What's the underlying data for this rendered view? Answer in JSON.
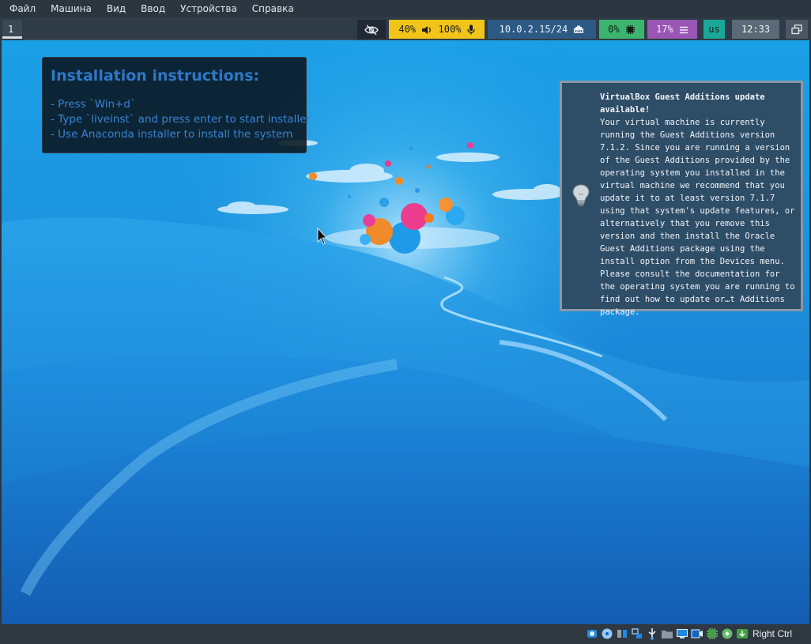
{
  "menubar": {
    "items": [
      "Файл",
      "Машина",
      "Вид",
      "Ввод",
      "Устройства",
      "Справка"
    ]
  },
  "bar": {
    "workspace": "1",
    "volume": "40%",
    "mic": "100%",
    "ip": "10.0.2.15/24",
    "cpu": "0%",
    "memory": "17%",
    "keyboard": "us",
    "clock": "12:33",
    "colors": {
      "audio": "#f0c419",
      "network": "#2d5a85",
      "cpu": "#3cb46d",
      "memory": "#9a56b5",
      "keyboard": "#1aa79a",
      "clock": "#5b6a78"
    }
  },
  "instructions": {
    "title": "Installation instructions:",
    "lines": [
      "- Press `Win+d`",
      "- Type `liveinst` and press enter to start installer",
      "- Use Anaconda installer to install the system"
    ]
  },
  "notification": {
    "title": "VirtualBox Guest Additions update available!",
    "body": "Your virtual machine is currently running the Guest Additions version 7.1.2. Since you are running a version of the Guest Additions provided by the operating system you installed in the virtual machine we recommend that you update it to at least version 7.1.7 using that system's update features, or alternatively that you remove this version and then install the Oracle Guest Additions package using the install option from the Devices menu. Please consult the documentation for the operating system you are running to find out how to update or…t Additions package.",
    "icon": "lightbulb-icon"
  },
  "statusbar": {
    "host_key": "Right Ctrl",
    "icons": [
      "hard-disk-icon",
      "optical-drive-icon",
      "audio-icon",
      "network-icon",
      "usb-icon",
      "shared-folder-icon",
      "display-icon",
      "video-capture-icon",
      "cpu-icon",
      "mouse-integration-icon",
      "keyboard-capture-icon"
    ]
  }
}
